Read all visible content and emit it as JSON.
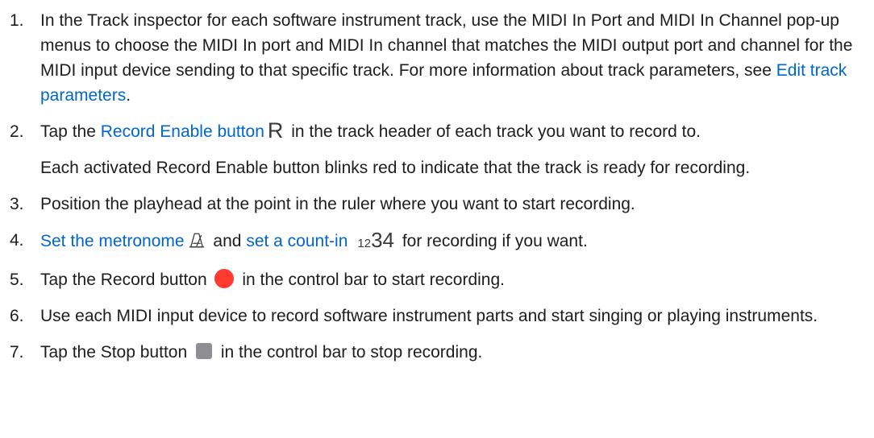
{
  "steps": [
    {
      "number": "1.",
      "text_a": "In the Track inspector for each software instrument track, use the MIDI In Port and MIDI In Channel pop-up menus to choose the MIDI In port and MIDI In channel that matches the MIDI output port and channel for the MIDI input device sending to that specific track. For more information about track parameters, see ",
      "link": "Edit track parameters",
      "text_b": "."
    },
    {
      "number": "2.",
      "text_a": "Tap the ",
      "link": "Record Enable button",
      "icon": "R",
      "text_b": " in the track header of each track you want to record to.",
      "note": "Each activated Record Enable button blinks red to indicate that the track is ready for recording."
    },
    {
      "number": "3.",
      "text_a": "Position the playhead at the point in the ruler where you want to start recording."
    },
    {
      "number": "4.",
      "link_a": "Set the metronome",
      "text_a": " and ",
      "link_b": "set a count-in",
      "icon_small": "12",
      "icon_big": "34",
      "text_b": " for recording if you want."
    },
    {
      "number": "5.",
      "text_a": "Tap the Record button ",
      "text_b": " in the control bar to start recording."
    },
    {
      "number": "6.",
      "text_a": "Use each MIDI input device to record software instrument parts and start singing or playing instruments."
    },
    {
      "number": "7.",
      "text_a": "Tap the Stop button ",
      "text_b": " in the control bar to stop recording."
    }
  ],
  "colors": {
    "text": "#1d1d1f",
    "link": "#0066cc",
    "record": "#ff3b30",
    "stop": "#8e8e93"
  },
  "icons": {
    "record_enable": "record-enable-icon",
    "metronome": "metronome-icon",
    "count_in": "count-in-icon",
    "record": "record-icon",
    "stop": "stop-icon"
  }
}
